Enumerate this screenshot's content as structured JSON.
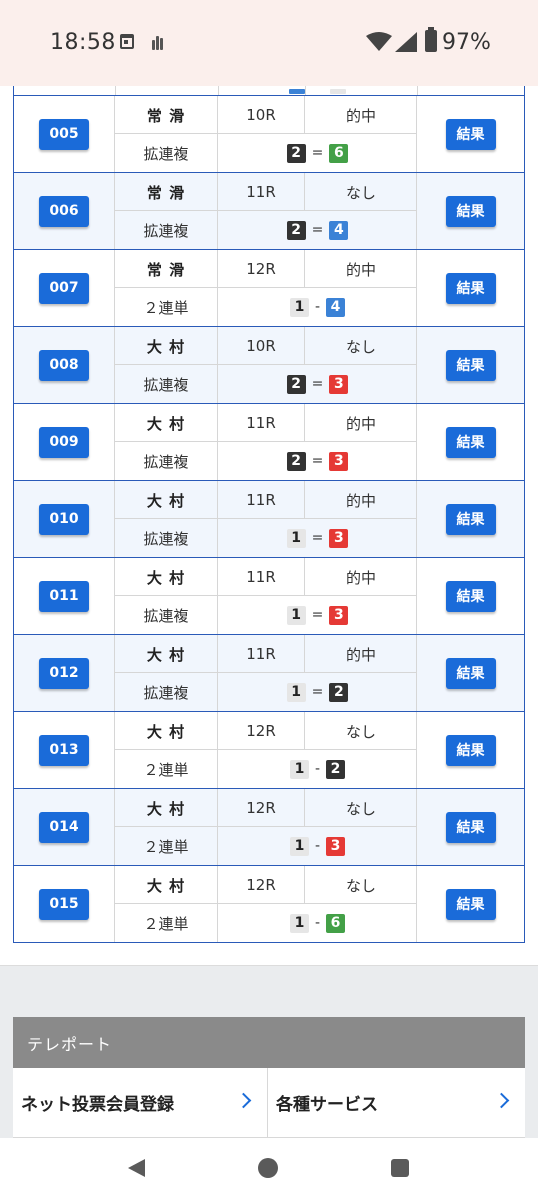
{
  "status_bar": {
    "time": "18:58",
    "battery_percent": "97%",
    "icons": [
      "calendar-icon",
      "app-notification-icon",
      "wifi-icon",
      "signal-icon",
      "battery-icon"
    ]
  },
  "colors": {
    "accent": "#1a6bd9",
    "row_border": "#2a5ab8",
    "row_alt_bg": "#f1f6fd",
    "chip_1": "#e6e6e6",
    "chip_2": "#333333",
    "chip_3": "#e53935",
    "chip_4": "#3b82d6",
    "chip_6": "#43a047"
  },
  "results": [
    {
      "id": "005",
      "venue": "常 滑",
      "race": "10R",
      "hit": "的中",
      "bet_type": "拡連複",
      "first": "2",
      "sep": "=",
      "second": "6",
      "button": "結果"
    },
    {
      "id": "006",
      "venue": "常 滑",
      "race": "11R",
      "hit": "なし",
      "bet_type": "拡連複",
      "first": "2",
      "sep": "=",
      "second": "4",
      "button": "結果"
    },
    {
      "id": "007",
      "venue": "常 滑",
      "race": "12R",
      "hit": "的中",
      "bet_type": "２連単",
      "first": "1",
      "sep": "-",
      "second": "4",
      "button": "結果"
    },
    {
      "id": "008",
      "venue": "大 村",
      "race": "10R",
      "hit": "なし",
      "bet_type": "拡連複",
      "first": "2",
      "sep": "=",
      "second": "3",
      "button": "結果"
    },
    {
      "id": "009",
      "venue": "大 村",
      "race": "11R",
      "hit": "的中",
      "bet_type": "拡連複",
      "first": "2",
      "sep": "=",
      "second": "3",
      "button": "結果"
    },
    {
      "id": "010",
      "venue": "大 村",
      "race": "11R",
      "hit": "的中",
      "bet_type": "拡連複",
      "first": "1",
      "sep": "=",
      "second": "3",
      "button": "結果"
    },
    {
      "id": "011",
      "venue": "大 村",
      "race": "11R",
      "hit": "的中",
      "bet_type": "拡連複",
      "first": "1",
      "sep": "=",
      "second": "3",
      "button": "結果"
    },
    {
      "id": "012",
      "venue": "大 村",
      "race": "11R",
      "hit": "的中",
      "bet_type": "拡連複",
      "first": "1",
      "sep": "=",
      "second": "2",
      "button": "結果"
    },
    {
      "id": "013",
      "venue": "大 村",
      "race": "12R",
      "hit": "なし",
      "bet_type": "２連単",
      "first": "1",
      "sep": "-",
      "second": "2",
      "button": "結果"
    },
    {
      "id": "014",
      "venue": "大 村",
      "race": "12R",
      "hit": "なし",
      "bet_type": "２連単",
      "first": "1",
      "sep": "-",
      "second": "3",
      "button": "結果"
    },
    {
      "id": "015",
      "venue": "大 村",
      "race": "12R",
      "hit": "なし",
      "bet_type": "２連単",
      "first": "1",
      "sep": "-",
      "second": "6",
      "button": "結果"
    }
  ],
  "teleport": {
    "title": "テレポート",
    "links": [
      {
        "label": "ネット投票会員登録",
        "icon": "chevron-right-icon"
      },
      {
        "label": "各種サービス",
        "icon": "chevron-right-icon"
      }
    ]
  },
  "nav_bar": {
    "icons": [
      "back-icon",
      "home-icon",
      "recents-icon"
    ]
  }
}
